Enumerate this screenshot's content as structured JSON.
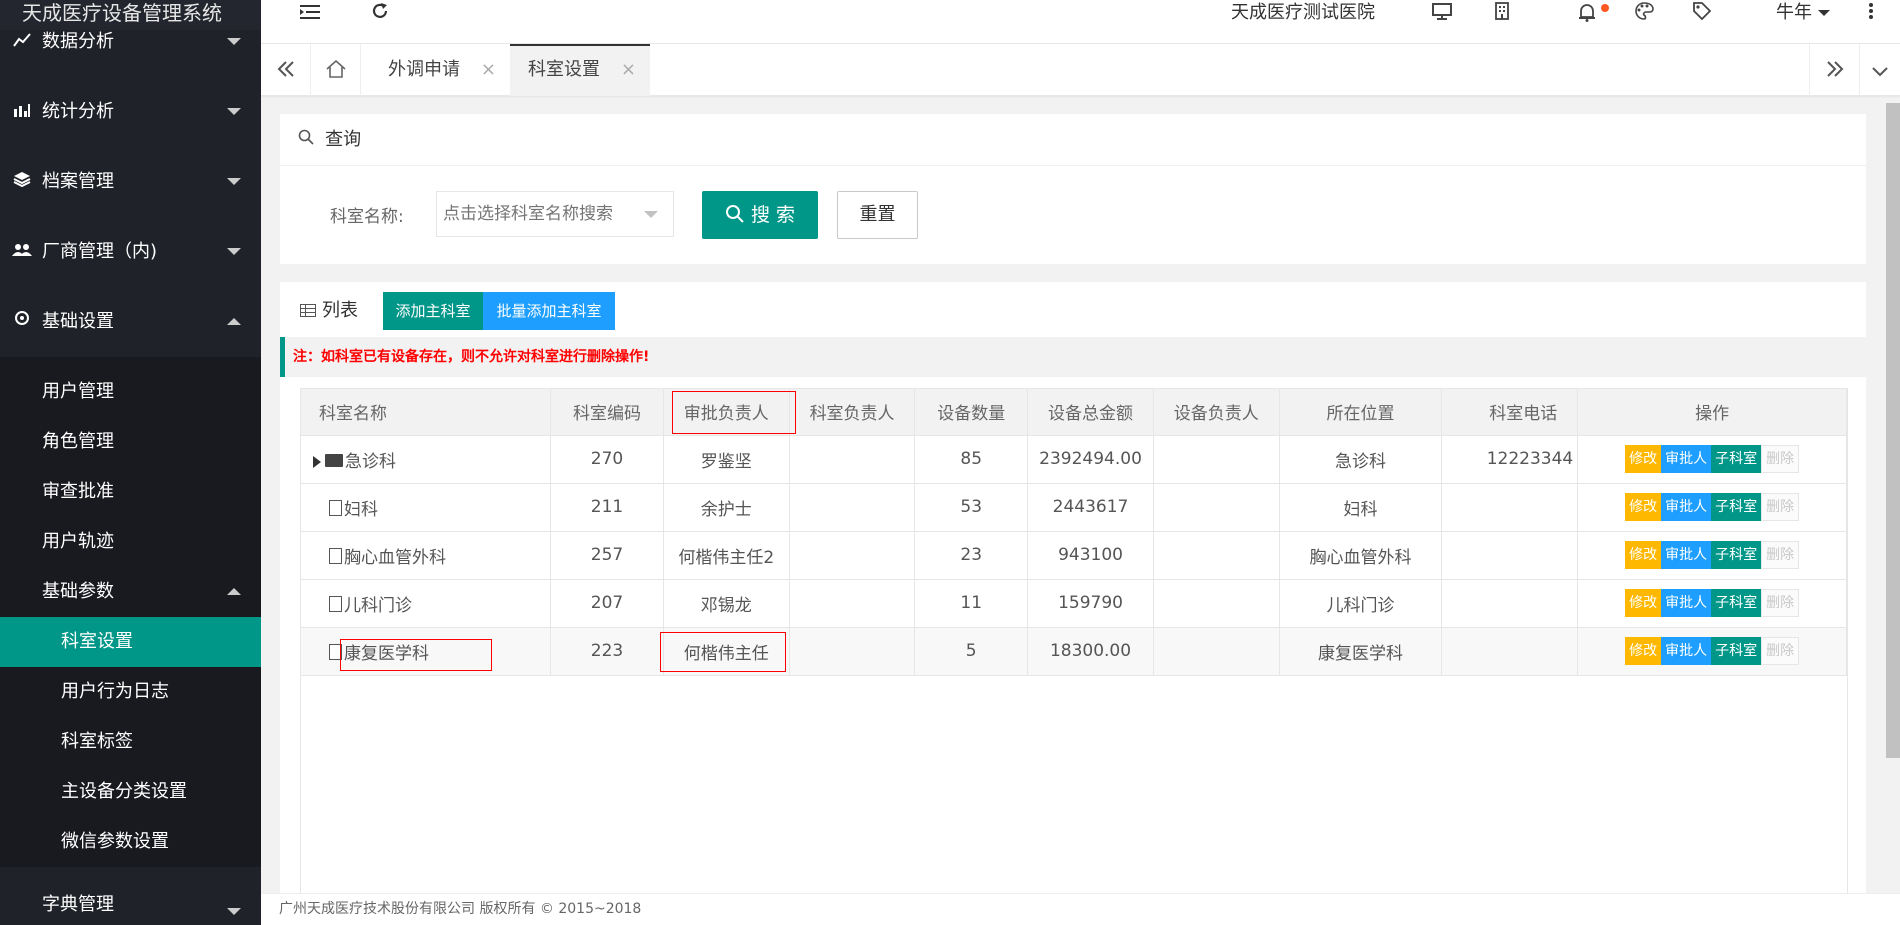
{
  "app": {
    "title": "天成医疗设备管理系统"
  },
  "sidebar": {
    "groups": [
      {
        "label": "数据分析",
        "icon": "line-chart-icon"
      },
      {
        "label": "统计分析",
        "icon": "bar-chart-icon"
      },
      {
        "label": "档案管理",
        "icon": "layers-icon"
      },
      {
        "label": "厂商管理（内)",
        "icon": "users-icon"
      },
      {
        "label": "基础设置",
        "icon": "gear-icon"
      }
    ],
    "basic_settings_items": [
      "用户管理",
      "角色管理",
      "审查批准",
      "用户轨迹",
      "基础参数"
    ],
    "basic_params_items": [
      "科室设置",
      "用户行为日志",
      "科室标签",
      "主设备分类设置",
      "微信参数设置"
    ],
    "active_item": "科室设置",
    "dict_label": "字典管理"
  },
  "header": {
    "hospital": "天成医疗测试医院",
    "user": "牛年",
    "icons": [
      "menu-fold-icon",
      "refresh-icon",
      "screen-icon",
      "building-icon",
      "bell-icon",
      "palette-icon",
      "tag-icon",
      "more-vertical-icon"
    ]
  },
  "tabs": [
    {
      "label": "外调申请",
      "close": "×"
    },
    {
      "label": "科室设置",
      "close": "×",
      "active": true
    }
  ],
  "query": {
    "title": "查询",
    "dept_label": "科室名称:",
    "dept_placeholder": "点击选择科室名称搜索",
    "search_label": "搜 索",
    "reset_label": "重置"
  },
  "list": {
    "title": "列表",
    "add_main_label": "添加主科室",
    "batch_add_label": "批量添加主科室",
    "notice": "注：如科室已有设备存在，则不允许对科室进行删除操作!"
  },
  "table": {
    "headers": [
      "科室名称",
      "科室编码",
      "审批负责人",
      "科室负责人",
      "设备数量",
      "设备总金额",
      "设备负责人",
      "所在位置",
      "科室电话",
      "操作"
    ],
    "rows": [
      {
        "name": "急诊科",
        "code": "270",
        "approver": "罗鉴坚",
        "manager": "",
        "count": "85",
        "amount": "2392494.00",
        "equip_mgr": "",
        "location": "急诊科",
        "phone": "12223344",
        "folder": true
      },
      {
        "name": "妇科",
        "code": "211",
        "approver": "余护士",
        "manager": "",
        "count": "53",
        "amount": "2443617",
        "equip_mgr": "",
        "location": "妇科",
        "phone": "",
        "folder": false
      },
      {
        "name": "胸心血管外科",
        "code": "257",
        "approver": "何楷伟主任2",
        "manager": "",
        "count": "23",
        "amount": "943100",
        "equip_mgr": "",
        "location": "胸心血管外科",
        "phone": "",
        "folder": false
      },
      {
        "name": "儿科门诊",
        "code": "207",
        "approver": "邓锡龙",
        "manager": "",
        "count": "11",
        "amount": "159790",
        "equip_mgr": "",
        "location": "儿科门诊",
        "phone": "",
        "folder": false
      },
      {
        "name": "康复医学科",
        "code": "223",
        "approver": "何楷伟主任",
        "manager": "",
        "count": "5",
        "amount": "18300.00",
        "equip_mgr": "",
        "location": "康复医学科",
        "phone": "",
        "folder": false
      }
    ],
    "ops": {
      "edit": "修改",
      "approver": "审批人",
      "child": "子科室",
      "delete": "删除"
    }
  },
  "footer": {
    "text": "广州天成医疗技术股份有限公司 版权所有 © 2015~2018"
  },
  "colors": {
    "primary": "#009688",
    "sidebar_bg": "#20222a",
    "blue": "#1e9fff",
    "orange": "#ffb800",
    "notice_red": "#ff0000"
  }
}
